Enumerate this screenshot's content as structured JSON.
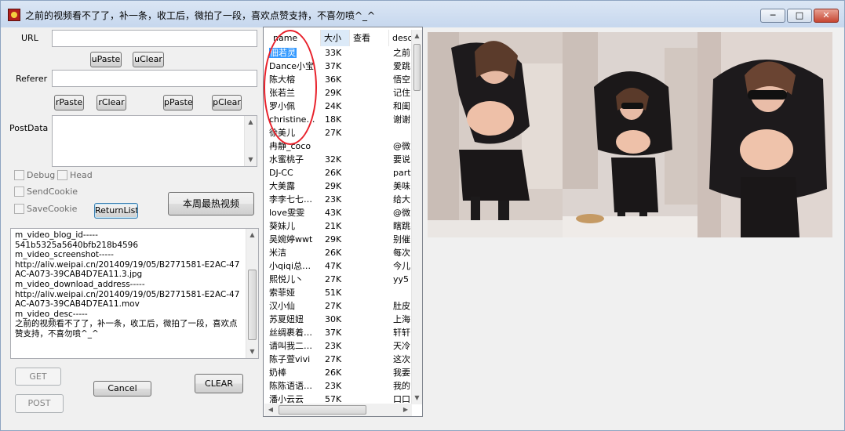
{
  "window": {
    "title": "之前的视频看不了了，补一条，收工后，微拍了一段，喜欢点赞支持，不喜勿喷^_^",
    "min_label": "─",
    "max_label": "□",
    "close_label": "✕"
  },
  "form": {
    "url_label": "URL",
    "referer_label": "Referer",
    "postdata_label": "PostData",
    "upaste": "uPaste",
    "uclear": "uClear",
    "rpaste": "rPaste",
    "rclear": "rClear",
    "ppaste": "pPaste",
    "pclear": "pClear",
    "debug": "Debug",
    "head": "Head",
    "sendcookie": "SendCookie",
    "savecookie": "SaveCookie",
    "returnlist": "ReturnList",
    "hot_videos": "本周最热视频",
    "get": "GET",
    "post": "POST",
    "cancel": "Cancel",
    "clear": "CLEAR"
  },
  "log": {
    "text": "m_video_blog_id-----\n541b5325a5640bfb218b4596\nm_video_screenshot-----\nhttp://aliv.weipai.cn/201409/19/05/B2771581-E2AC-47AC-A073-39CAB4D7EA11.3.jpg\nm_video_download_address-----\nhttp://aliv.weipai.cn/201409/19/05/B2771581-E2AC-47AC-A073-39CAB4D7EA11.mov\nm_video_desc-----\n之前的视频看不了了，补一条，收工后，微拍了一段，喜欢点赞支持，不喜勿喷^_^"
  },
  "list": {
    "columns": [
      "name",
      "大小",
      "查看",
      "desc"
    ],
    "rows": [
      {
        "name": "佃若灵",
        "size": "33K",
        "views": "",
        "desc": "之前"
      },
      {
        "name": "Dance小宝",
        "size": "37K",
        "views": "",
        "desc": "爱跳"
      },
      {
        "name": "陈大榕",
        "size": "36K",
        "views": "",
        "desc": "悟空"
      },
      {
        "name": "张若兰",
        "size": "29K",
        "views": "",
        "desc": "记住"
      },
      {
        "name": "罗小佩",
        "size": "24K",
        "views": "",
        "desc": "和闺"
      },
      {
        "name": "christine…",
        "size": "18K",
        "views": "",
        "desc": "谢谢"
      },
      {
        "name": "徐美儿",
        "size": "27K",
        "views": "",
        "desc": ""
      },
      {
        "name": "冉静_coco",
        "size": "",
        "views": "",
        "desc": "@微"
      },
      {
        "name": "水蜜桃子",
        "size": "32K",
        "views": "",
        "desc": "要说"
      },
      {
        "name": "DJ-CC",
        "size": "26K",
        "views": "",
        "desc": "part"
      },
      {
        "name": "大美露",
        "size": "29K",
        "views": "",
        "desc": "美味"
      },
      {
        "name": "李李七七…",
        "size": "23K",
        "views": "",
        "desc": "给大"
      },
      {
        "name": "love雯雯",
        "size": "43K",
        "views": "",
        "desc": "@微"
      },
      {
        "name": "葵妹儿",
        "size": "21K",
        "views": "",
        "desc": "瞎跳"
      },
      {
        "name": "吴婉婷wwt",
        "size": "29K",
        "views": "",
        "desc": "别催"
      },
      {
        "name": "米洁",
        "size": "26K",
        "views": "",
        "desc": "每次"
      },
      {
        "name": "小qiqi总…",
        "size": "47K",
        "views": "",
        "desc": "今儿"
      },
      {
        "name": "熙悦儿丶",
        "size": "27K",
        "views": "",
        "desc": "yy5"
      },
      {
        "name": "索菲娅",
        "size": "51K",
        "views": "",
        "desc": ""
      },
      {
        "name": "汉小仙",
        "size": "27K",
        "views": "",
        "desc": "肚皮"
      },
      {
        "name": "苏夏妞妞",
        "size": "30K",
        "views": "",
        "desc": "上海"
      },
      {
        "name": "丝绸裹着…",
        "size": "37K",
        "views": "",
        "desc": "轩轩"
      },
      {
        "name": "请叫我二…",
        "size": "23K",
        "views": "",
        "desc": "天冷"
      },
      {
        "name": "陈子萱vivi",
        "size": "27K",
        "views": "",
        "desc": "这次"
      },
      {
        "name": "奶棒",
        "size": "26K",
        "views": "",
        "desc": "我要"
      },
      {
        "name": "陈陈语语…",
        "size": "23K",
        "views": "",
        "desc": "我的"
      },
      {
        "name": "潘小云云",
        "size": "57K",
        "views": "",
        "desc": "口口"
      }
    ]
  },
  "icons": {
    "scroll_up": "▲",
    "scroll_down": "▼",
    "scroll_left": "◀",
    "scroll_right": "▶"
  }
}
